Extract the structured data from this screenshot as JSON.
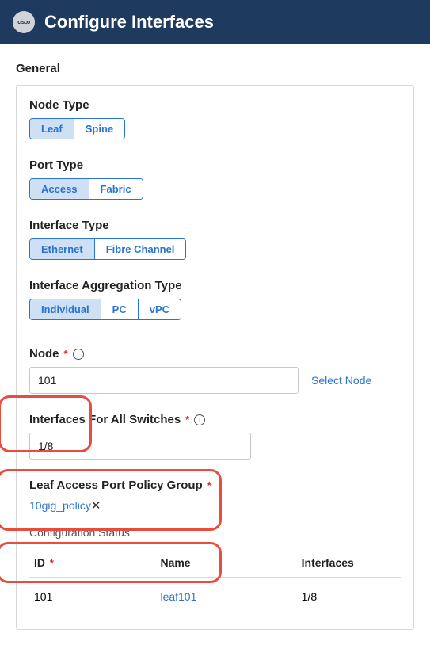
{
  "header": {
    "logo_text": "cisco",
    "title": "Configure Interfaces"
  },
  "section": {
    "heading": "General"
  },
  "node_type": {
    "label": "Node Type",
    "options": [
      "Leaf",
      "Spine"
    ],
    "selected": 0
  },
  "port_type": {
    "label": "Port Type",
    "options": [
      "Access",
      "Fabric"
    ],
    "selected": 0
  },
  "interface_type": {
    "label": "Interface Type",
    "options": [
      "Ethernet",
      "Fibre Channel"
    ],
    "selected": 0
  },
  "aggregation_type": {
    "label": "Interface Aggregation Type",
    "options": [
      "Individual",
      "PC",
      "vPC"
    ],
    "selected": 0
  },
  "node": {
    "label": "Node",
    "value": "101",
    "select_link": "Select Node"
  },
  "interfaces": {
    "label": "Interfaces For All Switches",
    "value": "1/8"
  },
  "policy_group": {
    "label": "Leaf Access Port Policy Group",
    "value": "10gig_policy"
  },
  "config_status": {
    "label": "Configuration Status",
    "columns": {
      "id": "ID",
      "name": "Name",
      "interfaces": "Interfaces"
    },
    "rows": [
      {
        "id": "101",
        "name": "leaf101",
        "interfaces": "1/8"
      }
    ]
  }
}
